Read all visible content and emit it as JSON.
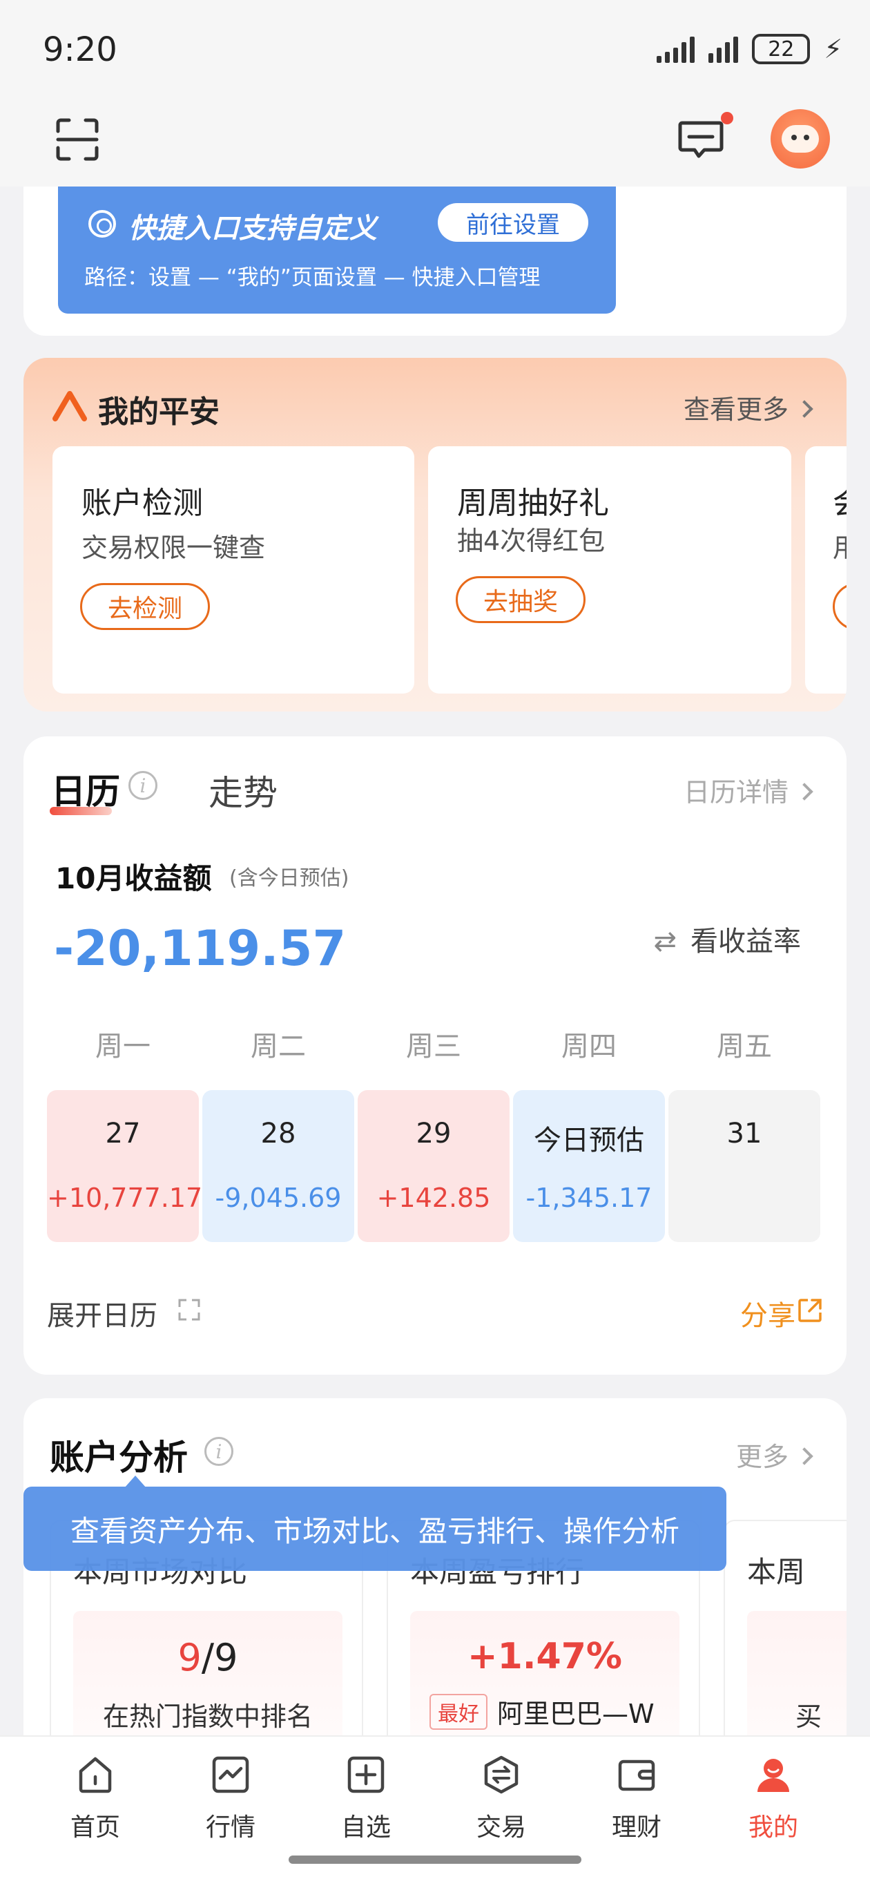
{
  "status_bar": {
    "time": "9:20",
    "battery": "22"
  },
  "tip_banner": {
    "title": "快捷入口支持自定义",
    "button": "前往设置",
    "path": "路径：设置 — “我的”页面设置 — 快捷入口管理"
  },
  "pingan": {
    "title": "我的平安",
    "more": "查看更多",
    "cards": [
      {
        "title": "账户检测",
        "subtitle": "交易权限一键查",
        "button": "去检测"
      },
      {
        "title": "周周抽好礼",
        "subtitle": "抽4次得红包",
        "button": "去抽奖"
      },
      {
        "title": "会",
        "subtitle": "用",
        "button": ""
      }
    ]
  },
  "calendar": {
    "tab_active": "日历",
    "tab_other": "走势",
    "detail_link": "日历详情",
    "month_label": "10月收益额",
    "month_note": "(含今日预估)",
    "month_value": "-20,119.57",
    "rate_link": "看收益率",
    "weekdays": [
      "周一",
      "周二",
      "周三",
      "周四",
      "周五"
    ],
    "days": [
      {
        "label": "27",
        "value": "+10,777.17",
        "tone": "up"
      },
      {
        "label": "28",
        "value": "-9,045.69",
        "tone": "down"
      },
      {
        "label": "29",
        "value": "+142.85",
        "tone": "up"
      },
      {
        "label": "今日预估",
        "value": "-1,345.17",
        "tone": "down"
      },
      {
        "label": "31",
        "value": "",
        "tone": "none"
      }
    ],
    "expand": "展开日历",
    "share": "分享"
  },
  "account_analysis": {
    "title": "账户分析",
    "more": "更多",
    "tooltip": "查看资产分布、市场对比、盈亏排行、操作分析",
    "cards": [
      {
        "title": "本周市场对比",
        "rank": "9",
        "rank_total": "/9",
        "subtitle": "在热门指数中排名"
      },
      {
        "title": "本周盈亏排行",
        "value": "+1.47%",
        "badge": "最好",
        "stock": "阿里巴巴—W"
      },
      {
        "title": "本周",
        "subtitle": "买"
      }
    ]
  },
  "bottom_nav": [
    {
      "label": "首页",
      "icon": "home-icon"
    },
    {
      "label": "行情",
      "icon": "chart-icon"
    },
    {
      "label": "自选",
      "icon": "plus-square-icon"
    },
    {
      "label": "交易",
      "icon": "exchange-icon"
    },
    {
      "label": "理财",
      "icon": "wallet-icon"
    },
    {
      "label": "我的",
      "icon": "profile-icon",
      "active": true
    }
  ],
  "colors": {
    "up": "#e8443e",
    "down": "#4a8fe8",
    "accent": "#f04e3e",
    "banner": "#5a93e8",
    "orange": "#e86a1a"
  }
}
